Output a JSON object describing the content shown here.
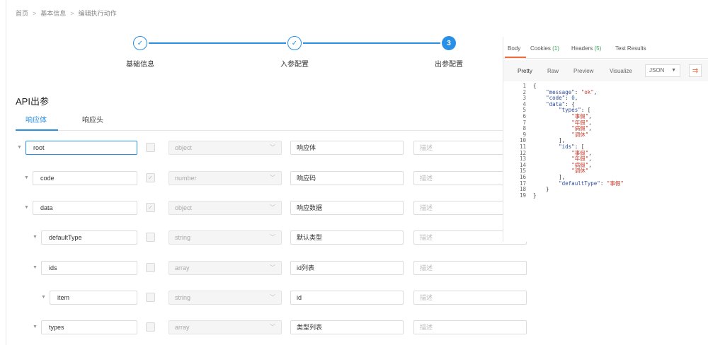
{
  "breadcrumb": [
    "首页",
    "基本信息",
    "编辑执行动作"
  ],
  "breadcrumb_sep": ">",
  "steps": [
    {
      "label": "基础信息",
      "state": "done",
      "icon": "check-icon"
    },
    {
      "label": "入参配置",
      "state": "done",
      "icon": "check-icon"
    },
    {
      "label": "出参配置",
      "state": "active",
      "number": "3"
    }
  ],
  "section_title": "API出参",
  "tabs": {
    "response_body": "响应体",
    "response_header": "响应头"
  },
  "rows": [
    {
      "name": "root",
      "checked": false,
      "type": "object",
      "desc": "响应体",
      "remark_placeholder": "描述"
    },
    {
      "name": "code",
      "checked": true,
      "type": "number",
      "desc": "响应码",
      "remark_placeholder": "描述"
    },
    {
      "name": "data",
      "checked": true,
      "type": "object",
      "desc": "响应数据",
      "remark_placeholder": "描述"
    },
    {
      "name": "defaultType",
      "checked": false,
      "type": "string",
      "desc": "默认类型",
      "remark_placeholder": "描述"
    },
    {
      "name": "ids",
      "checked": false,
      "type": "array",
      "desc": "id列表",
      "remark_placeholder": "描述"
    },
    {
      "name": "item",
      "checked": false,
      "type": "string",
      "desc": "id",
      "remark_placeholder": "描述"
    },
    {
      "name": "types",
      "checked": false,
      "type": "array",
      "desc": "类型列表",
      "remark_placeholder": "描述"
    }
  ],
  "panel": {
    "tabs": {
      "body": "Body",
      "cookies": "Cookies",
      "cookies_count": "(1)",
      "headers": "Headers",
      "headers_count": "(5)",
      "test_results": "Test Results"
    },
    "toolbar": {
      "pretty": "Pretty",
      "raw": "Raw",
      "preview": "Preview",
      "visualize": "Visualize",
      "format": "JSON"
    },
    "accent_color": "#f26b3a",
    "code_lines": [
      "{",
      "    \"message\": \"ok\",",
      "    \"code\": 0,",
      "    \"data\": {",
      "        \"types\": [",
      "            \"事假\",",
      "            \"年假\",",
      "            \"病假\",",
      "            \"调休\"",
      "        ],",
      "        \"ids\": [",
      "            \"事假\",",
      "            \"年假\",",
      "            \"病假\",",
      "            \"调休\"",
      "        ],",
      "        \"defaultType\": \"事假\"",
      "    }",
      "}"
    ]
  },
  "colors": {
    "primary": "#2a8fe6",
    "check_green": "#3aa55d"
  }
}
